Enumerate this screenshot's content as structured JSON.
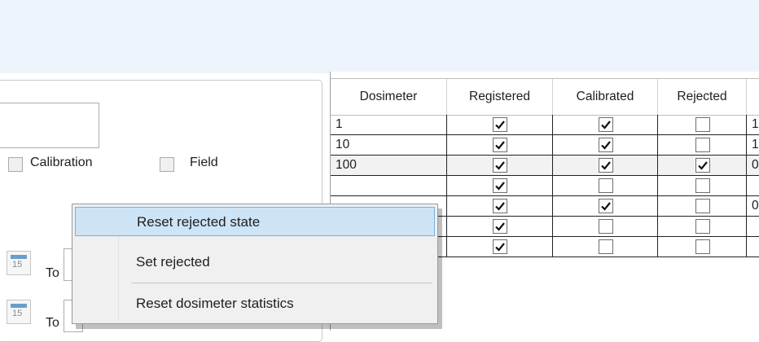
{
  "filters": {
    "calibration_label": "Calibration",
    "field_label": "Field",
    "calendar_day": "15",
    "to_label": "To"
  },
  "grid": {
    "columns": [
      "Dosimeter",
      "Registered",
      "Calibrated",
      "Rejected",
      ""
    ],
    "rows": [
      {
        "dosimeter": "1",
        "registered": true,
        "calibrated": true,
        "rejected": false,
        "next": "1"
      },
      {
        "dosimeter": "10",
        "registered": true,
        "calibrated": true,
        "rejected": false,
        "next": "1"
      },
      {
        "dosimeter": "100",
        "registered": true,
        "calibrated": true,
        "rejected": true,
        "next": "0"
      },
      {
        "dosimeter": "",
        "registered": true,
        "calibrated": false,
        "rejected": false,
        "next": ""
      },
      {
        "dosimeter": "",
        "registered": true,
        "calibrated": true,
        "rejected": false,
        "next": "0"
      },
      {
        "dosimeter": "",
        "registered": true,
        "calibrated": false,
        "rejected": false,
        "next": ""
      },
      {
        "dosimeter": "",
        "registered": true,
        "calibrated": false,
        "rejected": false,
        "next": ""
      }
    ]
  },
  "context_menu": {
    "items": [
      {
        "label": "Reset rejected state"
      },
      {
        "label": "Set rejected"
      },
      {
        "label": "Reset dosimeter statistics"
      }
    ]
  }
}
